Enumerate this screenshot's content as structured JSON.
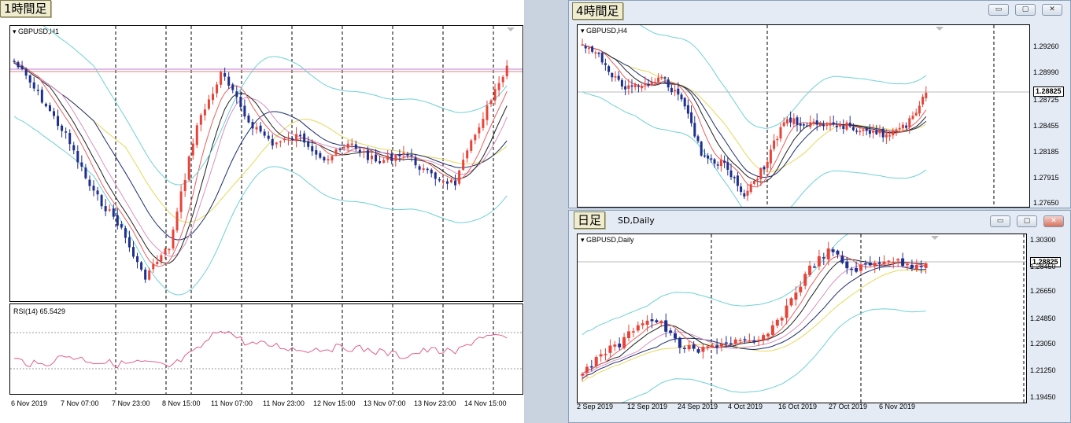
{
  "h1": {
    "tag": "1時間足",
    "symbol": "GBPUSD,H1",
    "rsi_label": "RSI(14) 65.5429",
    "time_labels": [
      "6 Nov 2019",
      "7 Nov 07:00",
      "7 Nov 23:00",
      "8 Nov 15:00",
      "11 Nov 07:00",
      "11 Nov 23:00",
      "12 Nov 15:00",
      "13 Nov 07:00",
      "13 Nov 23:00",
      "14 Nov 15:00"
    ]
  },
  "h4": {
    "tag": "4時間足",
    "symbol": "GBPUSD,H4",
    "prices": [
      "1.29260",
      "1.28990",
      "1.28825",
      "1.28725",
      "1.28455",
      "1.28185",
      "1.27915",
      "1.27650"
    ],
    "current": "1.28825"
  },
  "daily": {
    "tag": "日足",
    "title": "SD,Daily",
    "symbol": "GBPUSD,Daily",
    "prices": [
      "1.30300",
      "1.28825",
      "1.28450",
      "1.26650",
      "1.24850",
      "1.23050",
      "1.21250",
      "1.19450"
    ],
    "current": "1.28825",
    "time_labels": [
      "2 Sep 2019",
      "12 Sep 2019",
      "24 Sep 2019",
      "4 Oct 2019",
      "16 Oct 2019",
      "27 Oct 2019",
      "6 Nov 2019"
    ]
  },
  "window_buttons": {
    "minimize": "▭",
    "restore": "▢",
    "close": "✕"
  },
  "colors": {
    "bull": "#e8433a",
    "bear": "#1f2f8f",
    "grid": "#000000",
    "band": "#6fd0d6",
    "rsi": "#e0608a"
  }
}
